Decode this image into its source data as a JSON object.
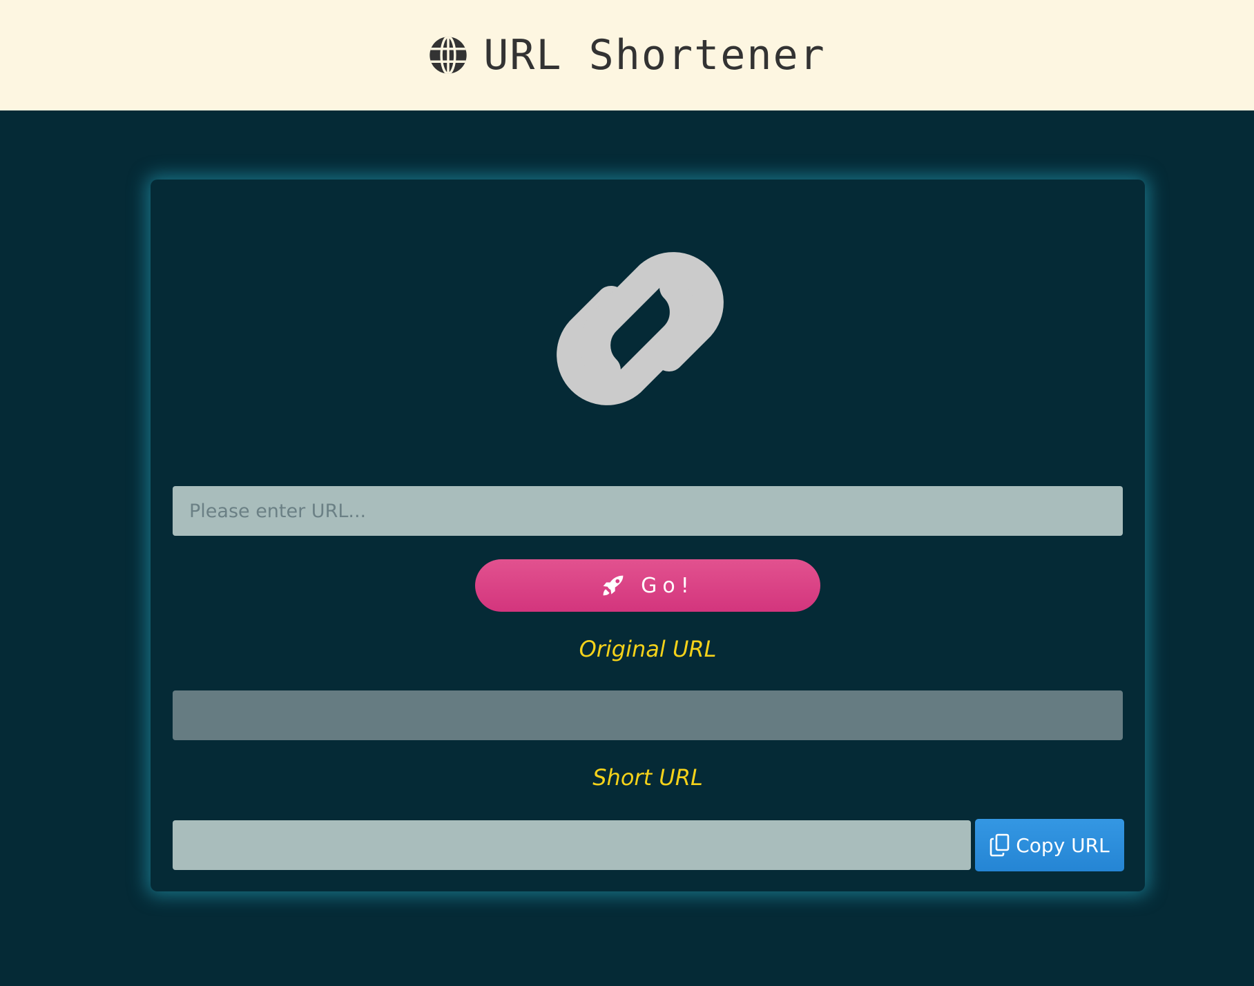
{
  "header": {
    "icon": "globe-icon",
    "title": "URL Shortener"
  },
  "main": {
    "logo_icon": "link-icon",
    "url_input": {
      "placeholder": "Please enter URL...",
      "value": ""
    },
    "go_button": {
      "icon": "rocket-icon",
      "label": "Go!"
    },
    "original_url": {
      "label": "Original URL",
      "value": ""
    },
    "short_url": {
      "label": "Short URL",
      "value": ""
    },
    "copy_button": {
      "icon": "copy-icon",
      "label": "Copy URL"
    }
  },
  "colors": {
    "background": "#052a36",
    "header_background": "#fdf6e1",
    "accent_pink": "#d93d83",
    "accent_blue": "#2d8fdc",
    "label_yellow": "#f5d21a",
    "card_glow": "#28aac3"
  }
}
